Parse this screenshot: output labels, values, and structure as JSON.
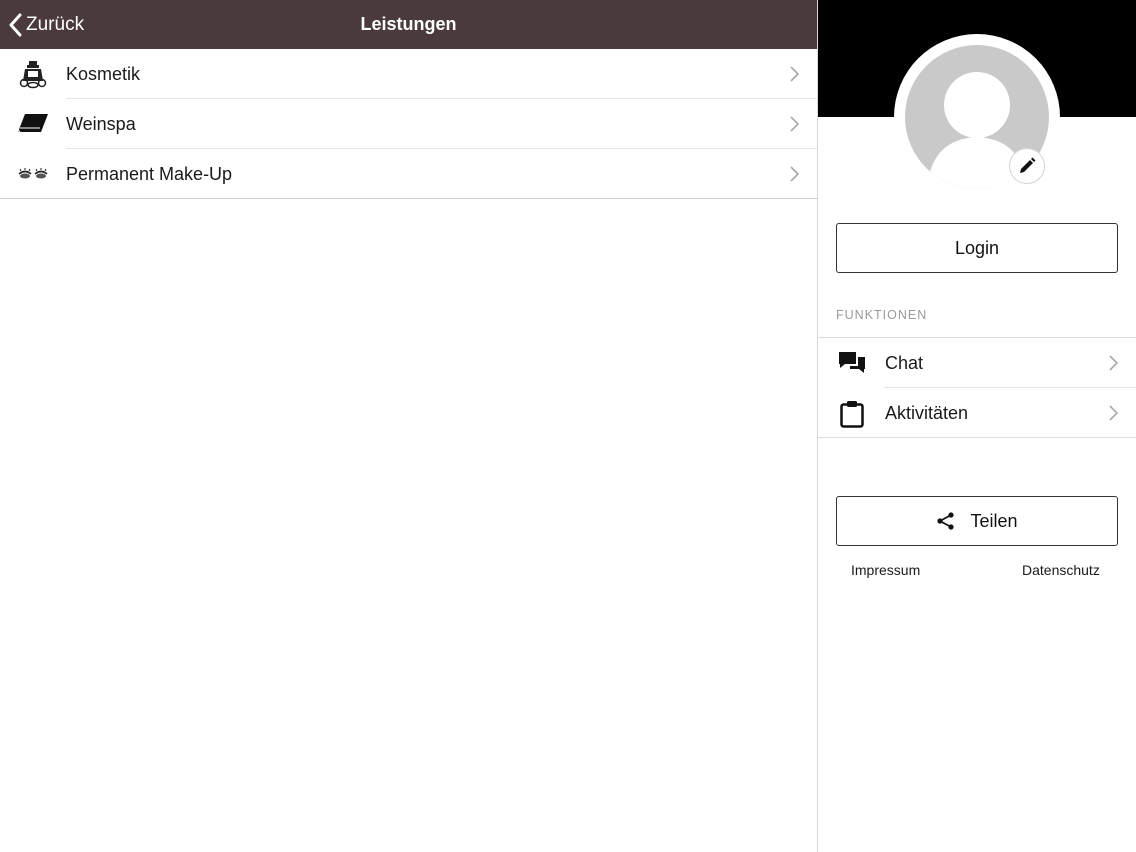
{
  "nav": {
    "back_label": "Zurück",
    "title": "Leistungen",
    "bar_color": "#4a3a3c"
  },
  "services": [
    {
      "label": "Kosmetik",
      "icon": "cosmetics-bottle-icon"
    },
    {
      "label": "Weinspa",
      "icon": "towel-icon"
    },
    {
      "label": "Permanent Make-Up",
      "icon": "eyelashes-icon"
    }
  ],
  "sidebar": {
    "login_label": "Login",
    "section_label": "FUNKTIONEN",
    "functions": [
      {
        "label": "Chat",
        "icon": "chat-bubbles-icon"
      },
      {
        "label": "Aktivitäten",
        "icon": "clipboard-icon"
      }
    ],
    "share_label": "Teilen",
    "footer": {
      "impressum": "Impressum",
      "datenschutz": "Datenschutz"
    }
  }
}
